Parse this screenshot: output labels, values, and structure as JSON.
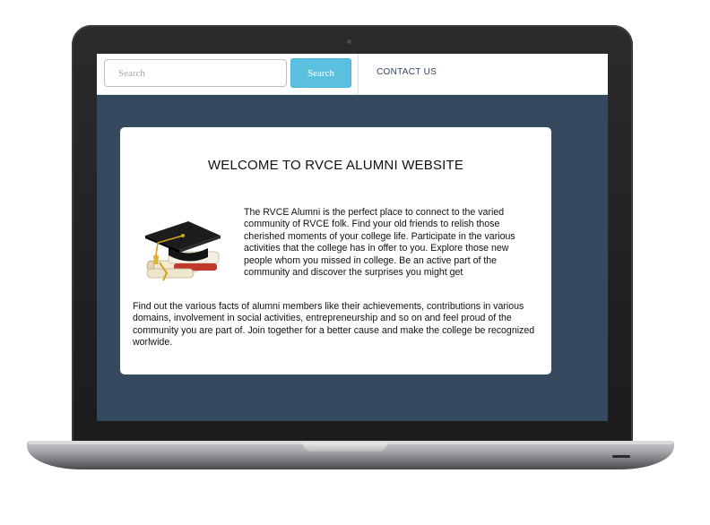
{
  "navbar": {
    "search_placeholder": "Search",
    "search_button": "Search",
    "contact_link": "CONTACT US"
  },
  "welcome": {
    "title": "WELCOME TO RVCE ALUMNI WEBSITE",
    "intro_paragraph": "The RVCE Alumni is the perfect place to connect to the varied community of RVCE folk. Find your old friends to relish those cherished moments of your college life. Participate in the various activities that the college has in offer to you. Explore those new people whom you missed in college. Be an active part of the community and discover the surprises you might get",
    "detail_paragraph": "Find out the various facts of alumni members like their achievements, contributions in various domains, involvement in social activities, entrepreneurship and so on and feel proud of the community you are part of. Join together for a better cause and make the college be recognized worlwide."
  },
  "colors": {
    "screen_background": "#34495e",
    "search_button": "#5bc0de",
    "card_background": "#ffffff"
  },
  "icons": {
    "hero_image": "graduation-cap-and-diploma"
  }
}
